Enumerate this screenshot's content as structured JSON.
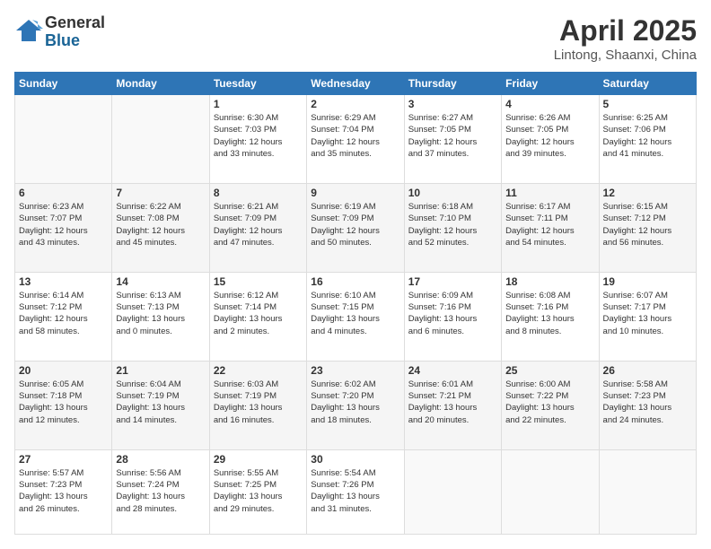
{
  "header": {
    "logo": {
      "general": "General",
      "blue": "Blue"
    },
    "title": "April 2025",
    "location": "Lintong, Shaanxi, China"
  },
  "weekdays": [
    "Sunday",
    "Monday",
    "Tuesday",
    "Wednesday",
    "Thursday",
    "Friday",
    "Saturday"
  ],
  "weeks": [
    [
      {
        "day": "",
        "info": ""
      },
      {
        "day": "",
        "info": ""
      },
      {
        "day": "1",
        "info": "Sunrise: 6:30 AM\nSunset: 7:03 PM\nDaylight: 12 hours\nand 33 minutes."
      },
      {
        "day": "2",
        "info": "Sunrise: 6:29 AM\nSunset: 7:04 PM\nDaylight: 12 hours\nand 35 minutes."
      },
      {
        "day": "3",
        "info": "Sunrise: 6:27 AM\nSunset: 7:05 PM\nDaylight: 12 hours\nand 37 minutes."
      },
      {
        "day": "4",
        "info": "Sunrise: 6:26 AM\nSunset: 7:05 PM\nDaylight: 12 hours\nand 39 minutes."
      },
      {
        "day": "5",
        "info": "Sunrise: 6:25 AM\nSunset: 7:06 PM\nDaylight: 12 hours\nand 41 minutes."
      }
    ],
    [
      {
        "day": "6",
        "info": "Sunrise: 6:23 AM\nSunset: 7:07 PM\nDaylight: 12 hours\nand 43 minutes."
      },
      {
        "day": "7",
        "info": "Sunrise: 6:22 AM\nSunset: 7:08 PM\nDaylight: 12 hours\nand 45 minutes."
      },
      {
        "day": "8",
        "info": "Sunrise: 6:21 AM\nSunset: 7:09 PM\nDaylight: 12 hours\nand 47 minutes."
      },
      {
        "day": "9",
        "info": "Sunrise: 6:19 AM\nSunset: 7:09 PM\nDaylight: 12 hours\nand 50 minutes."
      },
      {
        "day": "10",
        "info": "Sunrise: 6:18 AM\nSunset: 7:10 PM\nDaylight: 12 hours\nand 52 minutes."
      },
      {
        "day": "11",
        "info": "Sunrise: 6:17 AM\nSunset: 7:11 PM\nDaylight: 12 hours\nand 54 minutes."
      },
      {
        "day": "12",
        "info": "Sunrise: 6:15 AM\nSunset: 7:12 PM\nDaylight: 12 hours\nand 56 minutes."
      }
    ],
    [
      {
        "day": "13",
        "info": "Sunrise: 6:14 AM\nSunset: 7:12 PM\nDaylight: 12 hours\nand 58 minutes."
      },
      {
        "day": "14",
        "info": "Sunrise: 6:13 AM\nSunset: 7:13 PM\nDaylight: 13 hours\nand 0 minutes."
      },
      {
        "day": "15",
        "info": "Sunrise: 6:12 AM\nSunset: 7:14 PM\nDaylight: 13 hours\nand 2 minutes."
      },
      {
        "day": "16",
        "info": "Sunrise: 6:10 AM\nSunset: 7:15 PM\nDaylight: 13 hours\nand 4 minutes."
      },
      {
        "day": "17",
        "info": "Sunrise: 6:09 AM\nSunset: 7:16 PM\nDaylight: 13 hours\nand 6 minutes."
      },
      {
        "day": "18",
        "info": "Sunrise: 6:08 AM\nSunset: 7:16 PM\nDaylight: 13 hours\nand 8 minutes."
      },
      {
        "day": "19",
        "info": "Sunrise: 6:07 AM\nSunset: 7:17 PM\nDaylight: 13 hours\nand 10 minutes."
      }
    ],
    [
      {
        "day": "20",
        "info": "Sunrise: 6:05 AM\nSunset: 7:18 PM\nDaylight: 13 hours\nand 12 minutes."
      },
      {
        "day": "21",
        "info": "Sunrise: 6:04 AM\nSunset: 7:19 PM\nDaylight: 13 hours\nand 14 minutes."
      },
      {
        "day": "22",
        "info": "Sunrise: 6:03 AM\nSunset: 7:19 PM\nDaylight: 13 hours\nand 16 minutes."
      },
      {
        "day": "23",
        "info": "Sunrise: 6:02 AM\nSunset: 7:20 PM\nDaylight: 13 hours\nand 18 minutes."
      },
      {
        "day": "24",
        "info": "Sunrise: 6:01 AM\nSunset: 7:21 PM\nDaylight: 13 hours\nand 20 minutes."
      },
      {
        "day": "25",
        "info": "Sunrise: 6:00 AM\nSunset: 7:22 PM\nDaylight: 13 hours\nand 22 minutes."
      },
      {
        "day": "26",
        "info": "Sunrise: 5:58 AM\nSunset: 7:23 PM\nDaylight: 13 hours\nand 24 minutes."
      }
    ],
    [
      {
        "day": "27",
        "info": "Sunrise: 5:57 AM\nSunset: 7:23 PM\nDaylight: 13 hours\nand 26 minutes."
      },
      {
        "day": "28",
        "info": "Sunrise: 5:56 AM\nSunset: 7:24 PM\nDaylight: 13 hours\nand 28 minutes."
      },
      {
        "day": "29",
        "info": "Sunrise: 5:55 AM\nSunset: 7:25 PM\nDaylight: 13 hours\nand 29 minutes."
      },
      {
        "day": "30",
        "info": "Sunrise: 5:54 AM\nSunset: 7:26 PM\nDaylight: 13 hours\nand 31 minutes."
      },
      {
        "day": "",
        "info": ""
      },
      {
        "day": "",
        "info": ""
      },
      {
        "day": "",
        "info": ""
      }
    ]
  ]
}
